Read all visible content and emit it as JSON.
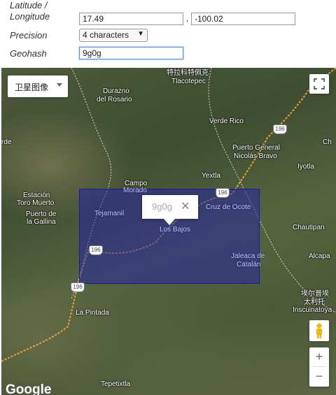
{
  "form": {
    "latlng_label": "Latitude / Longitude",
    "latlng_label_line1": "Latitude /",
    "latlng_label_line2": "Longitude",
    "latitude": "17.49",
    "separator": ",",
    "longitude": "-100.02",
    "precision_label": "Precision",
    "precision_value": "4 characters",
    "geohash_label": "Geohash",
    "geohash_value": "9g0g"
  },
  "map": {
    "map_type_label": "卫星图像",
    "info_window_text": "9g0g",
    "attribution": "Google",
    "zoom_in": "+",
    "zoom_out": "−",
    "route_shield": "196",
    "places": [
      {
        "name": "特拉科特佩克",
        "style": "white"
      },
      {
        "name": "Tlacotepec",
        "style": "white"
      },
      {
        "name": "Durazno",
        "style": "white"
      },
      {
        "name": "del Rosario",
        "style": "white"
      },
      {
        "name": "Verde Rico",
        "style": "white"
      },
      {
        "name": "rde",
        "style": "white"
      },
      {
        "name": "Puerto General",
        "style": "white"
      },
      {
        "name": "Nicolás Bravo",
        "style": "white"
      },
      {
        "name": "Ch",
        "style": "white"
      },
      {
        "name": "Yextla",
        "style": "white"
      },
      {
        "name": "Iyotla",
        "style": "white"
      },
      {
        "name": "Campo",
        "style": "white"
      },
      {
        "name": "Morado",
        "style": "blue"
      },
      {
        "name": "Estación",
        "style": "white"
      },
      {
        "name": "Toro Muerto",
        "style": "white"
      },
      {
        "name": "Puerto de",
        "style": "white"
      },
      {
        "name": "la Gallina",
        "style": "white"
      },
      {
        "name": "Tejamanil",
        "style": "blue"
      },
      {
        "name": "Cruz de Ocote",
        "style": "blue"
      },
      {
        "name": "Los Bajos",
        "style": "blue"
      },
      {
        "name": "Chautipan",
        "style": "white"
      },
      {
        "name": "Jaleaca de",
        "style": "blue"
      },
      {
        "name": "Catalán",
        "style": "blue"
      },
      {
        "name": "Alcapa",
        "style": "white"
      },
      {
        "name": "埃尔普埃",
        "style": "white"
      },
      {
        "name": "太利托",
        "style": "white"
      },
      {
        "name": "Inscuinatoya",
        "style": "white"
      },
      {
        "name": "La Pintada",
        "style": "white"
      },
      {
        "name": "Tepetixtla",
        "style": "white"
      }
    ],
    "colors": {
      "geohash_fill": "#1e1eaa",
      "road": "#e8a23a",
      "border": "#d8d8d8"
    }
  }
}
